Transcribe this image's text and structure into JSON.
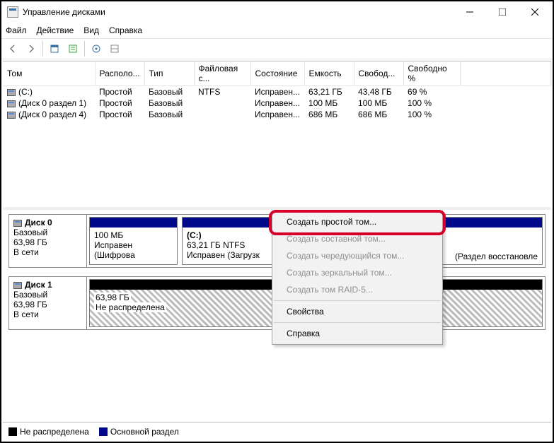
{
  "window": {
    "title": "Управление дисками"
  },
  "menu": {
    "file": "Файл",
    "action": "Действие",
    "view": "Вид",
    "help": "Справка"
  },
  "columns": {
    "volume": "Том",
    "layout": "Располо...",
    "type": "Тип",
    "fs": "Файловая с...",
    "status": "Состояние",
    "capacity": "Емкость",
    "free": "Свобод...",
    "freepct": "Свободно %"
  },
  "rows": [
    {
      "vol": "(C:)",
      "layout": "Простой",
      "type": "Базовый",
      "fs": "NTFS",
      "status": "Исправен...",
      "cap": "63,21 ГБ",
      "free": "43,48 ГБ",
      "pct": "69 %"
    },
    {
      "vol": "(Диск 0 раздел 1)",
      "layout": "Простой",
      "type": "Базовый",
      "fs": "",
      "status": "Исправен...",
      "cap": "100 МБ",
      "free": "100 МБ",
      "pct": "100 %"
    },
    {
      "vol": "(Диск 0 раздел 4)",
      "layout": "Простой",
      "type": "Базовый",
      "fs": "",
      "status": "Исправен...",
      "cap": "686 МБ",
      "free": "686 МБ",
      "pct": "100 %"
    }
  ],
  "disk0": {
    "name": "Диск 0",
    "type": "Базовый",
    "size": "63,98 ГБ",
    "status": "В сети",
    "p1": {
      "l1": "",
      "l2": "100 МБ",
      "l3": "Исправен (Шифрова"
    },
    "p2": {
      "l1": "(C:)",
      "l2": "63,21 ГБ NTFS",
      "l3": "Исправен (Загрузк"
    },
    "p3": {
      "l1": "",
      "l2": "",
      "l3": "(Раздел восстановле"
    }
  },
  "disk1": {
    "name": "Диск 1",
    "type": "Базовый",
    "size": "63,98 ГБ",
    "status": "В сети",
    "p1": {
      "l2": "63,98 ГБ",
      "l3": "Не распределена"
    }
  },
  "ctx": {
    "simple": "Создать простой том...",
    "spanned": "Создать составной том...",
    "striped": "Создать чередующийся том...",
    "mirror": "Создать зеркальный том...",
    "raid5": "Создать том RAID-5...",
    "props": "Свойства",
    "help": "Справка"
  },
  "legend": {
    "unalloc": "Не распределена",
    "primary": "Основной раздел"
  }
}
